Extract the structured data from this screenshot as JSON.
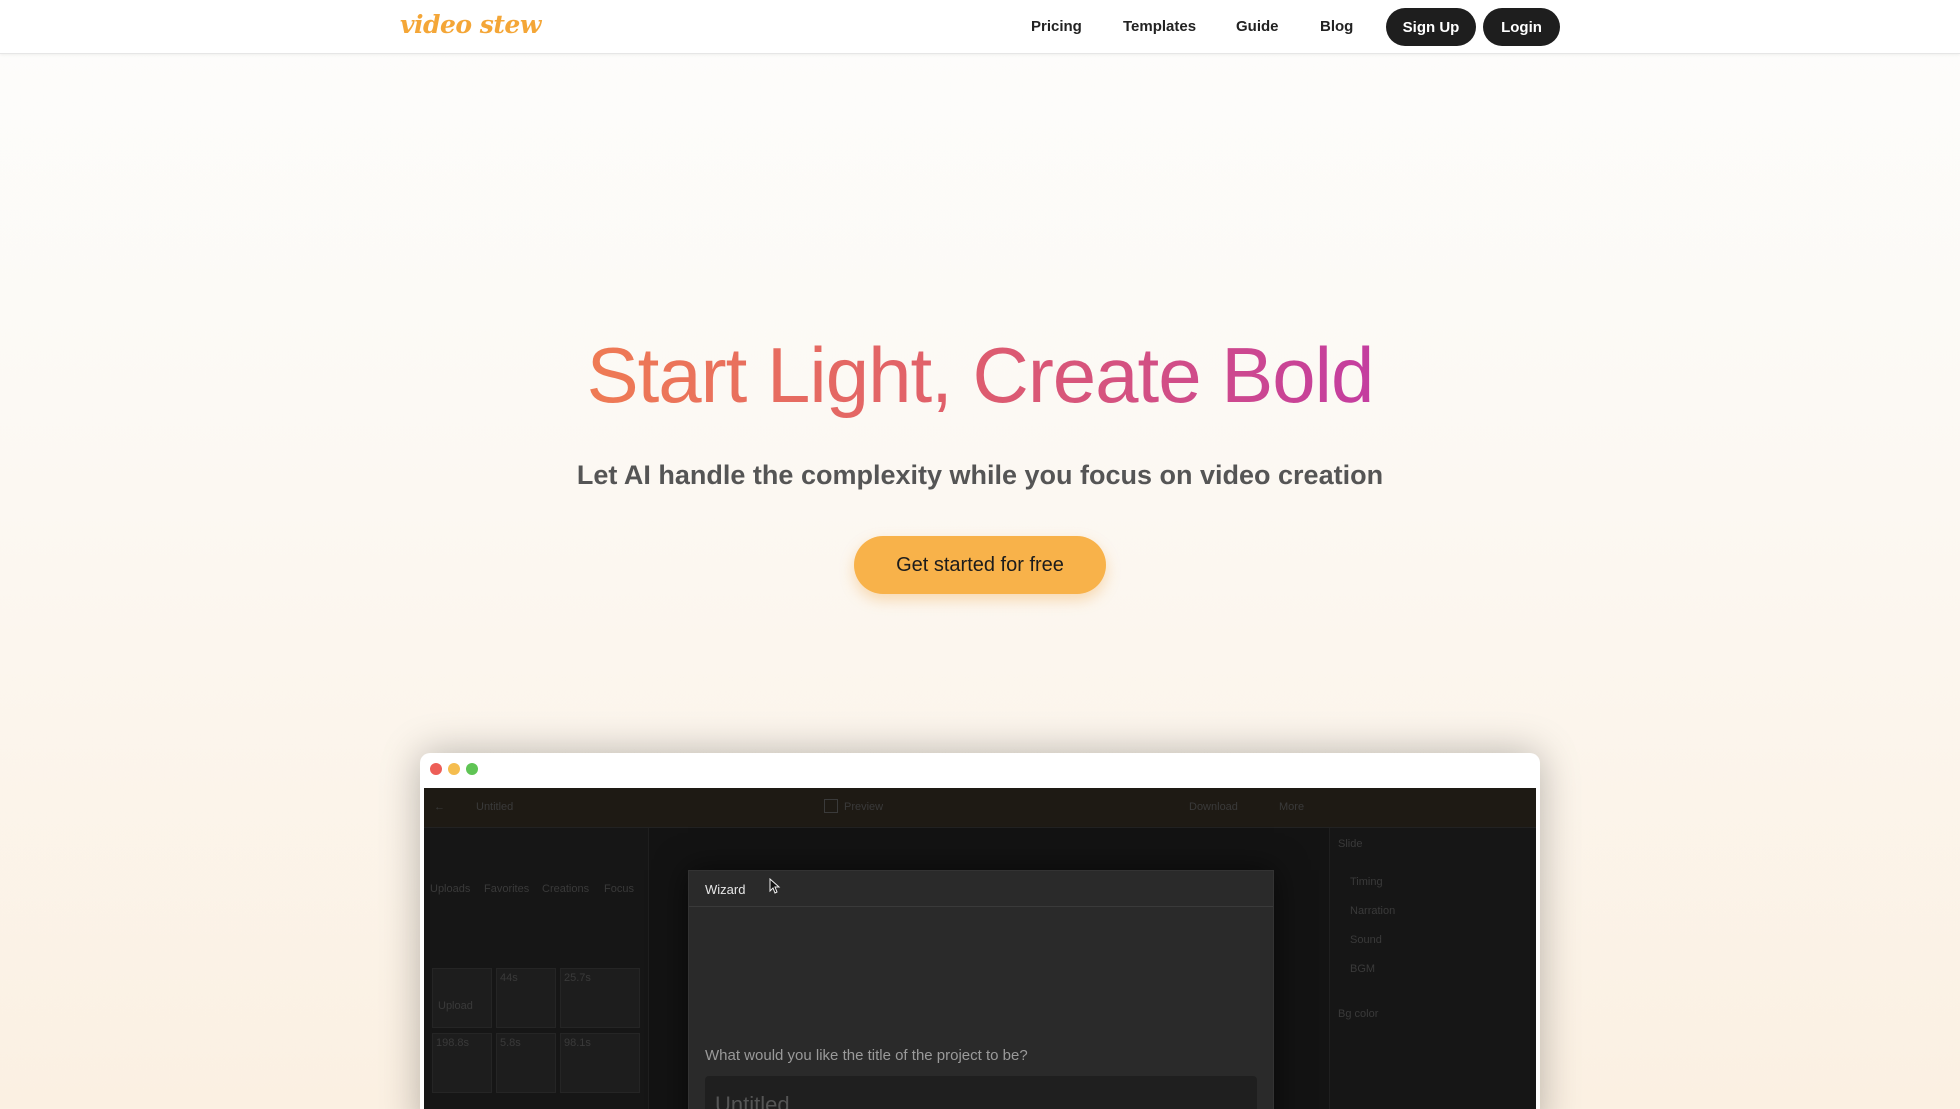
{
  "header": {
    "logo": "video stew",
    "nav": [
      "Pricing",
      "Templates",
      "Guide",
      "Blog"
    ],
    "signup_label": "Sign Up",
    "login_label": "Login"
  },
  "hero": {
    "title": "Start Light, Create Bold",
    "subtitle": "Let AI handle the complexity while you focus on video creation",
    "cta_label": "Get started for free"
  },
  "mock": {
    "window_dots": [
      "#ed5e57",
      "#f5bd4f",
      "#5fc454"
    ],
    "app": {
      "project_name": "Untitled",
      "preview_label": "Preview",
      "download_label": "Download",
      "more_label": "More",
      "left_tabs": [
        "Uploads",
        "Favorites",
        "Creations",
        "Focus"
      ],
      "upload_label": "Upload",
      "thumb_durations": [
        "44s",
        "25.7s",
        "198.8s",
        "5.8s",
        "98.1s"
      ],
      "right_title": "Slide",
      "right_items": [
        "Timing",
        "Narration",
        "Sound",
        "BGM"
      ],
      "bg_color_label": "Bg color"
    },
    "wizard": {
      "title": "Wizard",
      "question": "What would you like the title of the project to be?",
      "input_value": "Untitled"
    }
  }
}
